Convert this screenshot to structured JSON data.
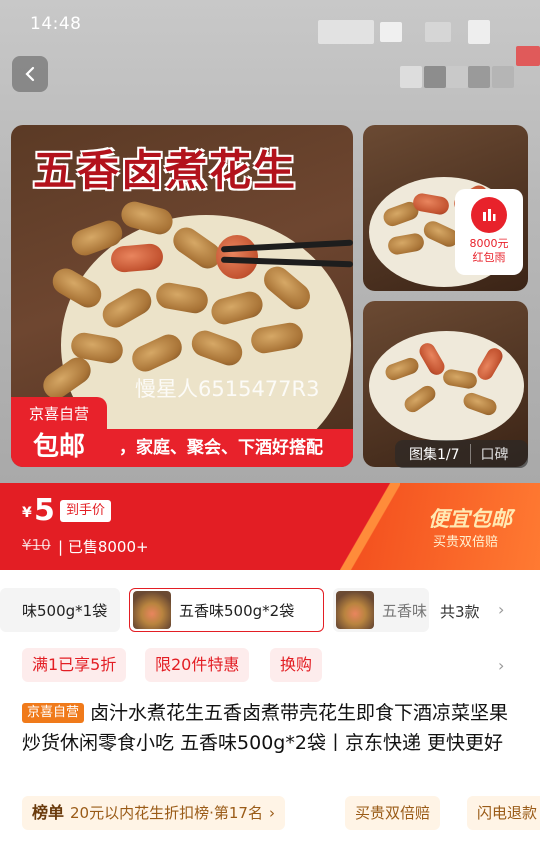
{
  "status": {
    "time": "14:48"
  },
  "gallery": {
    "banner_text": "五香卤煮花生",
    "watermark": "慢星人6515477R3",
    "jx_badge_top": "京喜自营",
    "jx_badge_bottom": "包邮",
    "slogan": "，家庭、聚会、下酒好搭配",
    "hongbao_amount": "8000元",
    "hongbao_label": "红包雨",
    "counter": "图集1/7",
    "koubei": "口碑"
  },
  "price": {
    "currency": "¥",
    "value": "5",
    "tag": "到手价",
    "original": "¥10",
    "sold": "| 已售8000+",
    "promo_title": "便宜包邮",
    "promo_sub": "买贵双倍赔"
  },
  "variants": {
    "items": [
      {
        "label": "味500g*1袋",
        "selected": false
      },
      {
        "label": "五香味500g*2袋",
        "selected": true
      },
      {
        "label": "五香味",
        "selected": false
      }
    ],
    "count_label": "共3款"
  },
  "promotions": [
    "满1已享5折",
    "限20件特惠",
    "换购"
  ],
  "product": {
    "store_tag": "京喜自营",
    "title": "卤汁水煮花生五香卤煮带壳花生即食下酒凉菜坚果炒货休闲零食小吃 五香味500g*2袋丨京东快递 更快更好"
  },
  "bottom": {
    "rank_label": "榜单",
    "rank_text": "20元以内花生折扣榜·第17名",
    "guarantee1": "买贵双倍赔",
    "guarantee2": "闪电退款"
  },
  "colors": {
    "accent": "#e31e24",
    "jx_orange": "#f07a1a"
  },
  "icons": [
    "back-arrow-icon",
    "hongbao-icon",
    "chevron-right-icon"
  ]
}
